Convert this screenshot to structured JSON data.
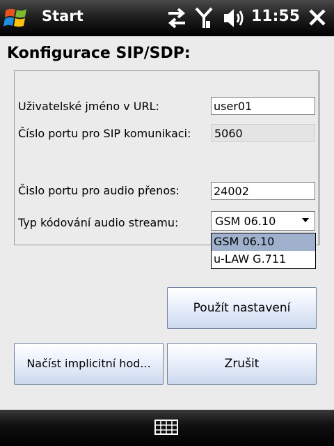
{
  "titlebar": {
    "title": "Start",
    "time": "11:55",
    "icons": [
      "windows-logo-icon",
      "connectivity-icon",
      "signal-antenna-icon",
      "volume-icon",
      "close-icon"
    ]
  },
  "page": {
    "title": "Konfigurace SIP/SDP:"
  },
  "form": {
    "username_label": "Uživatelské jméno v URL:",
    "username_value": "user01",
    "sip_port_label": "Číslo portu pro SIP komunikaci:",
    "sip_port_value": "5060",
    "audio_port_label": "Čislo portu pro audio přenos:",
    "audio_port_value": "24002",
    "codec_label": "Typ kódování audio streamu:",
    "codec_selected": "GSM 06.10",
    "codec_options": [
      "GSM 06.10",
      "u-LAW G.711"
    ]
  },
  "buttons": {
    "apply": "Použít nastavení",
    "load_defaults": "Načíst implicitní hod...",
    "cancel": "Zrušit"
  },
  "colors": {
    "titlebar": "#000000",
    "selection": "#9fb1cd",
    "button_border": "#6e7f99",
    "background": "#ebebeb"
  }
}
